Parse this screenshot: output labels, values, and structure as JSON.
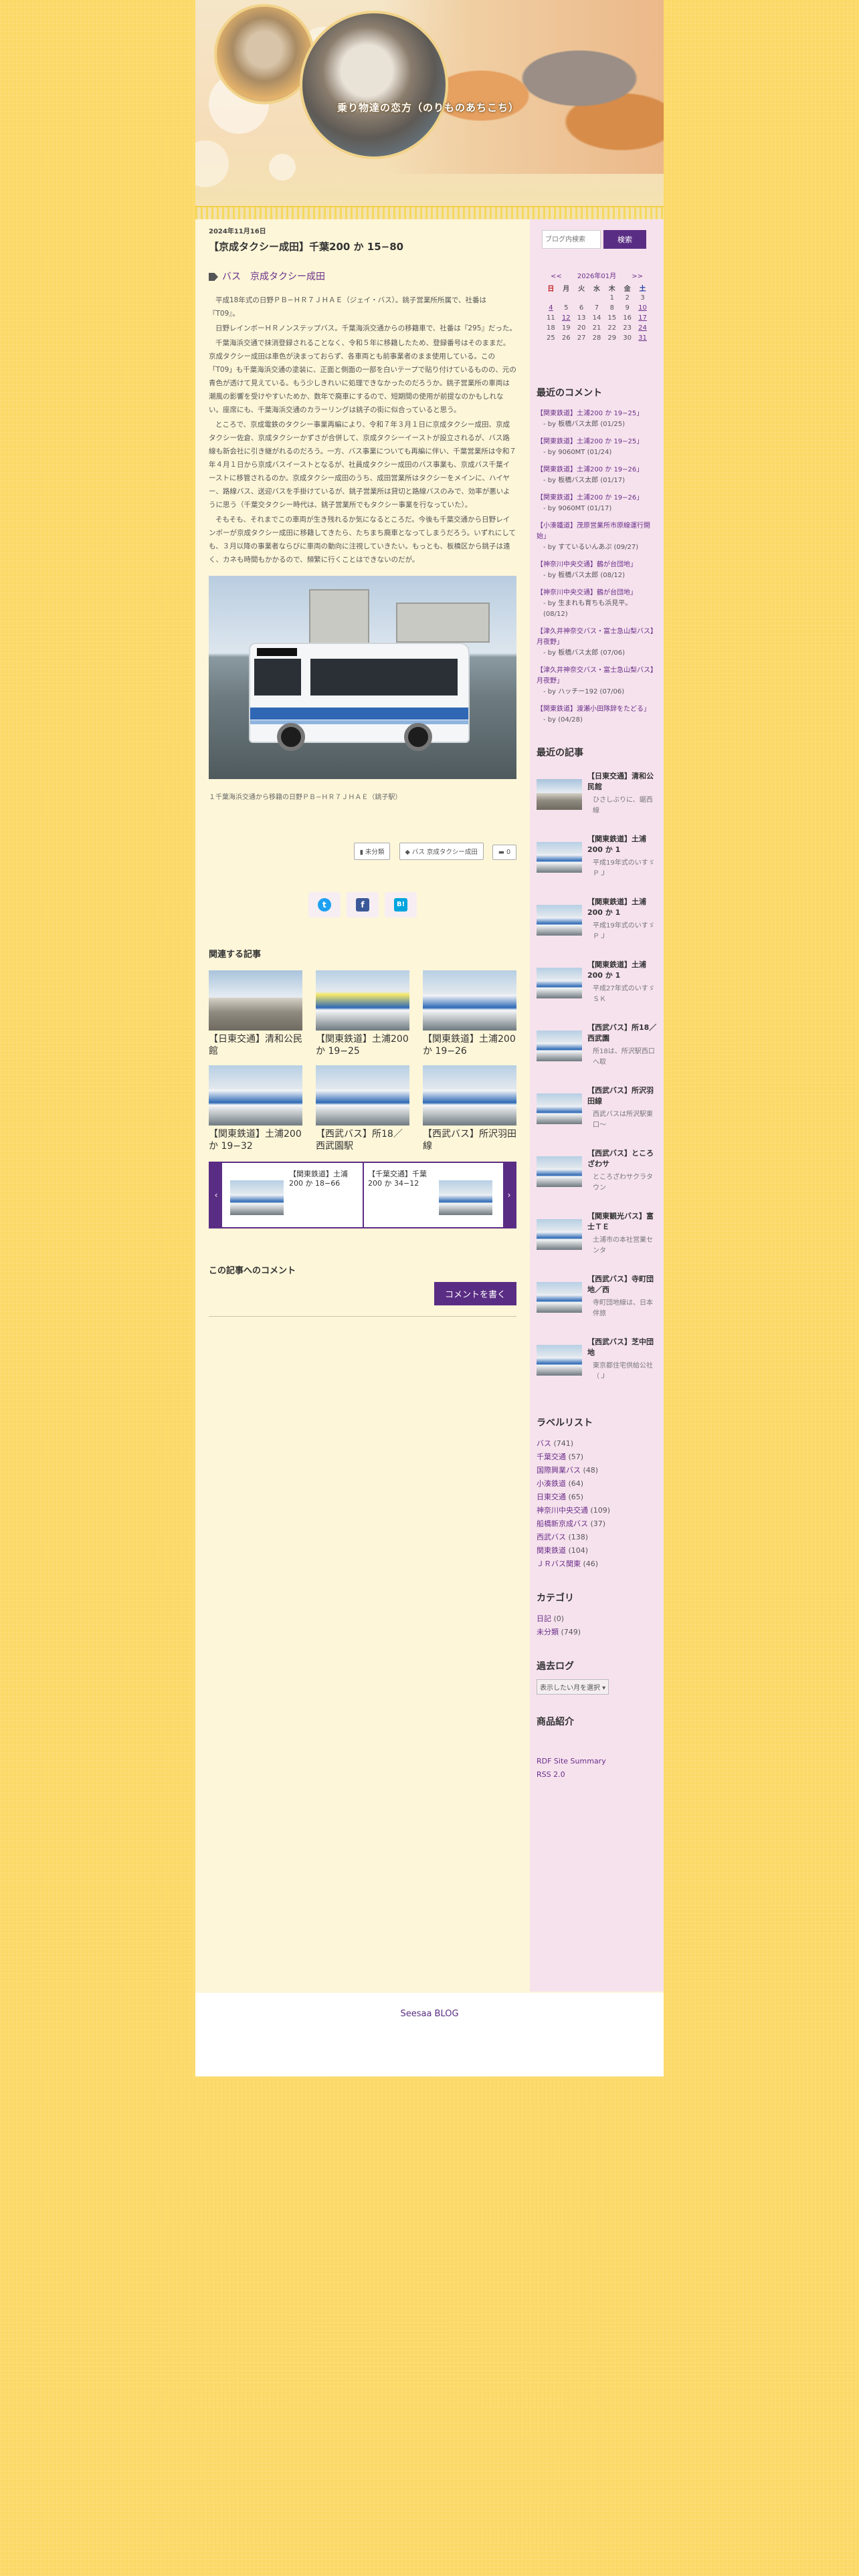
{
  "site": {
    "title": "乗り物達の恋方（のりものあちこち）"
  },
  "post": {
    "date": "2024年11月16日",
    "title": "【京成タクシー成田】千葉200 か 15−80",
    "labels": "バス　京成タクシー成田",
    "paragraphs": [
      "平成18年式の日野ＰＢ−ＨＲ７ＪＨＡＥ（ジェイ・バス）。銚子営業所所属で、社番は『T09』。",
      "日野レインボーＨＲノンステップバス。千葉海浜交通からの移籍車で、社番は『295』だった。",
      "千葉海浜交通で抹消登録されることなく、令和５年に移籍したため、登録番号はそのままだ。京成タクシー成田は車色が決まっておらず、各車両とも前事業者のまま使用している。この「T09」も千葉海浜交通の塗装に、正面と側面の一部を白いテープで貼り付けているものの、元の青色が透けて見えている。もう少しきれいに処理できなかったのだろうか。銚子営業所の車両は潮風の影響を受けやすいためか、数年で廃車にするので、短期間の使用が前提なのかもしれない。座席にも、千葉海浜交通のカラーリングは銚子の街に似合っていると思う。",
      "ところで、京成電鉄のタクシー事業再編により、令和７年３月１日に京成タクシー成田、京成タクシー佐倉、京成タクシーかずさが合併して、京成タクシーイーストが設立されるが、バス路線も新会社に引き継がれるのだろう。一方、バス事業についても再編に伴い、千葉営業所は令和７年４月１日から京成バスイーストとなるが、社員成タクシー成田のバス事業も、京成バス千葉イーストに移管されるのか。京成タクシー成田のうち、成田営業所はタクシーをメインに、ハイヤー、路線バス、送迎バスを手掛けているが、銚子営業所は貸切と路線バスのみで、効率が悪いように思う（千葉交タクシー時代は、銚子営業所でもタクシー事業を行なっていた）。",
      "そもそも、それまでこの車両が生き残れるか気になるところだ。今後も千葉交通から日野レインボーが京成タクシー成田に移籍してきたら、たちまち廃車となってしまうだろう。いずれにしても、３月以降の事業者ならびに車両の動向に注視していきたい。もっとも、板橋区から銚子は遠く、カネも時間もかかるので、頻繁に行くことはできないのだが。"
    ],
    "photo_caption": "１千葉海浜交通から移籍の日野ＰＢ−ＨＲ７ＪＨＡＥ（銚子駅）",
    "meta": {
      "category": "未分類",
      "labels": "バス 京成タクシー成田",
      "comments": "0"
    },
    "share": {
      "twitter": "t",
      "facebook": "f",
      "hatena": "B!"
    }
  },
  "related": {
    "title": "関連する記事",
    "items": [
      "【日東交通】清和公民館",
      "【関東鉄道】土浦200 か 19−25",
      "【関東鉄道】土浦200 か 19−26",
      "【関東鉄道】土浦200 か 19−32",
      "【西武バス】所18／西武園駅",
      "【西武バス】所沢羽田線"
    ],
    "carousel": [
      "【関東鉄道】土浦200 か 18−66",
      "【千葉交通】千葉200 か 34−12"
    ],
    "prev": "‹",
    "next": "›"
  },
  "comments": {
    "title": "この記事へのコメント",
    "button": "コメントを書く"
  },
  "sidebar": {
    "search": {
      "placeholder": "ブログ内検索",
      "button": "検索"
    },
    "calendar": {
      "prev": "<<",
      "month": "2026年01月",
      "next": ">>",
      "weekdays": [
        "日",
        "月",
        "火",
        "水",
        "木",
        "金",
        "土"
      ],
      "weeks": [
        [
          "",
          "",
          "",
          "",
          "1",
          "2",
          "3"
        ],
        [
          "4",
          "5",
          "6",
          "7",
          "8",
          "9",
          "10"
        ],
        [
          "11",
          "12",
          "13",
          "14",
          "15",
          "16",
          "17"
        ],
        [
          "18",
          "19",
          "20",
          "21",
          "22",
          "23",
          "24"
        ],
        [
          "25",
          "26",
          "27",
          "28",
          "29",
          "30",
          "31"
        ]
      ]
    },
    "recent_comments_title": "最近のコメント",
    "recent_comments": [
      {
        "title": "【関東鉄道】土浦200 か 19−25」",
        "by": "- by 板橋バス太郎 (01/25)"
      },
      {
        "title": "【関東鉄道】土浦200 か 19−25」",
        "by": "- by 9060MT (01/24)"
      },
      {
        "title": "【関東鉄道】土浦200 か 19−26」",
        "by": "- by 板橋バス太郎 (01/17)"
      },
      {
        "title": "【関東鉄道】土浦200 か 19−26」",
        "by": "- by 9060MT (01/17)"
      },
      {
        "title": "【小湊鐵道】茂原営業所市原線運行開始」",
        "by": "- by すているいんあぷ (09/27)"
      },
      {
        "title": "【神奈川中央交通】鶴が台団地」",
        "by": "- by 板橋バス太郎 (08/12)"
      },
      {
        "title": "【神奈川中央交通】鶴が台団地」",
        "by": "- by 生まれも育ちも浜見平。 (08/12)"
      },
      {
        "title": "【津久井神奈交バス・富士急山梨バス】月夜野」",
        "by": "- by 板橋バス太郎 (07/06)"
      },
      {
        "title": "【津久井神奈交バス・富士急山梨バス】月夜野」",
        "by": "- by ハッチー192 (07/06)"
      },
      {
        "title": "【関東鉄道】渡瀬小田隊辞をたどる」",
        "by": "- by  (04/28)"
      }
    ],
    "recent_articles_title": "最近の記事",
    "recent_articles": [
      {
        "title": "【日東交通】清和公民館",
        "desc": "ひさしぶりに、鋸西線"
      },
      {
        "title": "【関東鉄道】土浦200 か 1",
        "desc": "平成19年式のいすゞＰＪ"
      },
      {
        "title": "【関東鉄道】土浦200 か 1",
        "desc": "平成19年式のいすゞＰＪ"
      },
      {
        "title": "【関東鉄道】土浦200 か 1",
        "desc": "平成27年式のいすゞＳＫ"
      },
      {
        "title": "【西武バス】所18／西武園",
        "desc": "所18は、所沢駅西口へ取"
      },
      {
        "title": "【西武バス】所沢羽田線",
        "desc": "西武バスは所沢駅東口〜"
      },
      {
        "title": "【西武バス】ところざわサ",
        "desc": "ところざわサクラタウン"
      },
      {
        "title": "【関東観光バス】富士ＴＥ",
        "desc": "土浦市の本社営業センタ"
      },
      {
        "title": "【西武バス】寺町団地／西",
        "desc": "寺町団地線は、日本伴旅"
      },
      {
        "title": "【西武バス】芝中団地",
        "desc": "東京都住宅供給公社（Ｊ"
      }
    ],
    "labels_title": "ラベルリスト",
    "labels": [
      {
        "name": "バス",
        "count": "(741)"
      },
      {
        "name": "千葉交通",
        "count": "(57)"
      },
      {
        "name": "国際興業バス",
        "count": "(48)"
      },
      {
        "name": "小湊鉄道",
        "count": "(64)"
      },
      {
        "name": "日東交通",
        "count": "(65)"
      },
      {
        "name": "神奈川中央交通",
        "count": "(109)"
      },
      {
        "name": "船橋新京成バス",
        "count": "(37)"
      },
      {
        "name": "西武バス",
        "count": "(138)"
      },
      {
        "name": "関東鉄道",
        "count": "(104)"
      },
      {
        "name": "ＪＲバス関東",
        "count": "(46)"
      }
    ],
    "category_title": "カテゴリ",
    "categories": [
      {
        "name": "日記",
        "count": "(0)"
      },
      {
        "name": "未分類",
        "count": "(749)"
      }
    ],
    "archive_title": "過去ログ",
    "archive_select": "表示したい月を選択 ▾",
    "products_title": "商品紹介",
    "feeds": [
      "RDF Site Summary",
      "RSS 2.0"
    ]
  },
  "footer": {
    "text": "Seesaa BLOG"
  }
}
